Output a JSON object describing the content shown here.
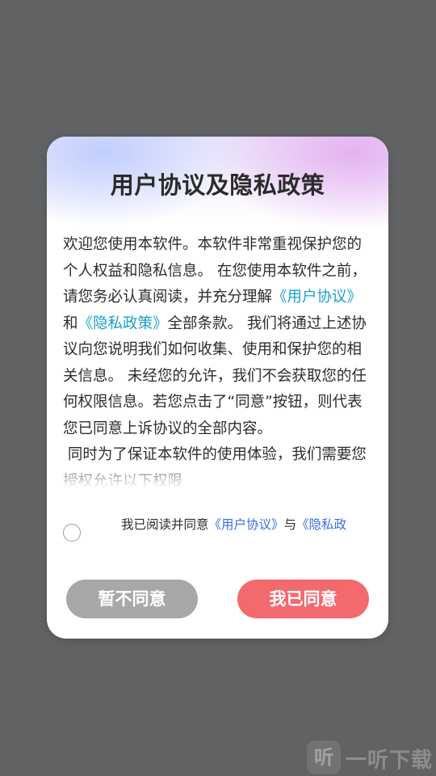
{
  "dialog": {
    "title": "用户协议及隐私政策",
    "body": {
      "p1_a": "欢迎您使用本软件。本软件非常重视保护您的个人权益和隐私信息。 在您使用本软件之前，请您务必认真阅读，并充分理解",
      "link_user_agreement": "《用户协议》",
      "p1_b": "和",
      "link_privacy_policy": "《隐私政策》",
      "p1_c": "全部条款。 我们将通过上述协议向您说明我们如何收集、使用和保护您的相关信息。 未经您的允许，我们不会获取您的任何权限信息。若您点击了“同意”按钮，则代表您已同意上诉协议的全部内容。",
      "p2": " 同时为了保证本软件的使用体验，我们需要您授权允许以下权限"
    },
    "agree": {
      "text_prefix": "我已阅读并同意",
      "link_user_agreement": "《用户协议》",
      "text_and": "与",
      "link_privacy_policy": "《隐私政"
    },
    "buttons": {
      "disagree": "暂不同意",
      "agree": "我已同意"
    }
  },
  "watermark": {
    "logo_glyph": "听",
    "text": "一听下载"
  },
  "colors": {
    "overlay": "#616264",
    "link": "#1aa0c8",
    "agree_link": "#3a6fe0",
    "agree_button": "#f26a6e",
    "disagree_button": "#a8a8a8"
  }
}
